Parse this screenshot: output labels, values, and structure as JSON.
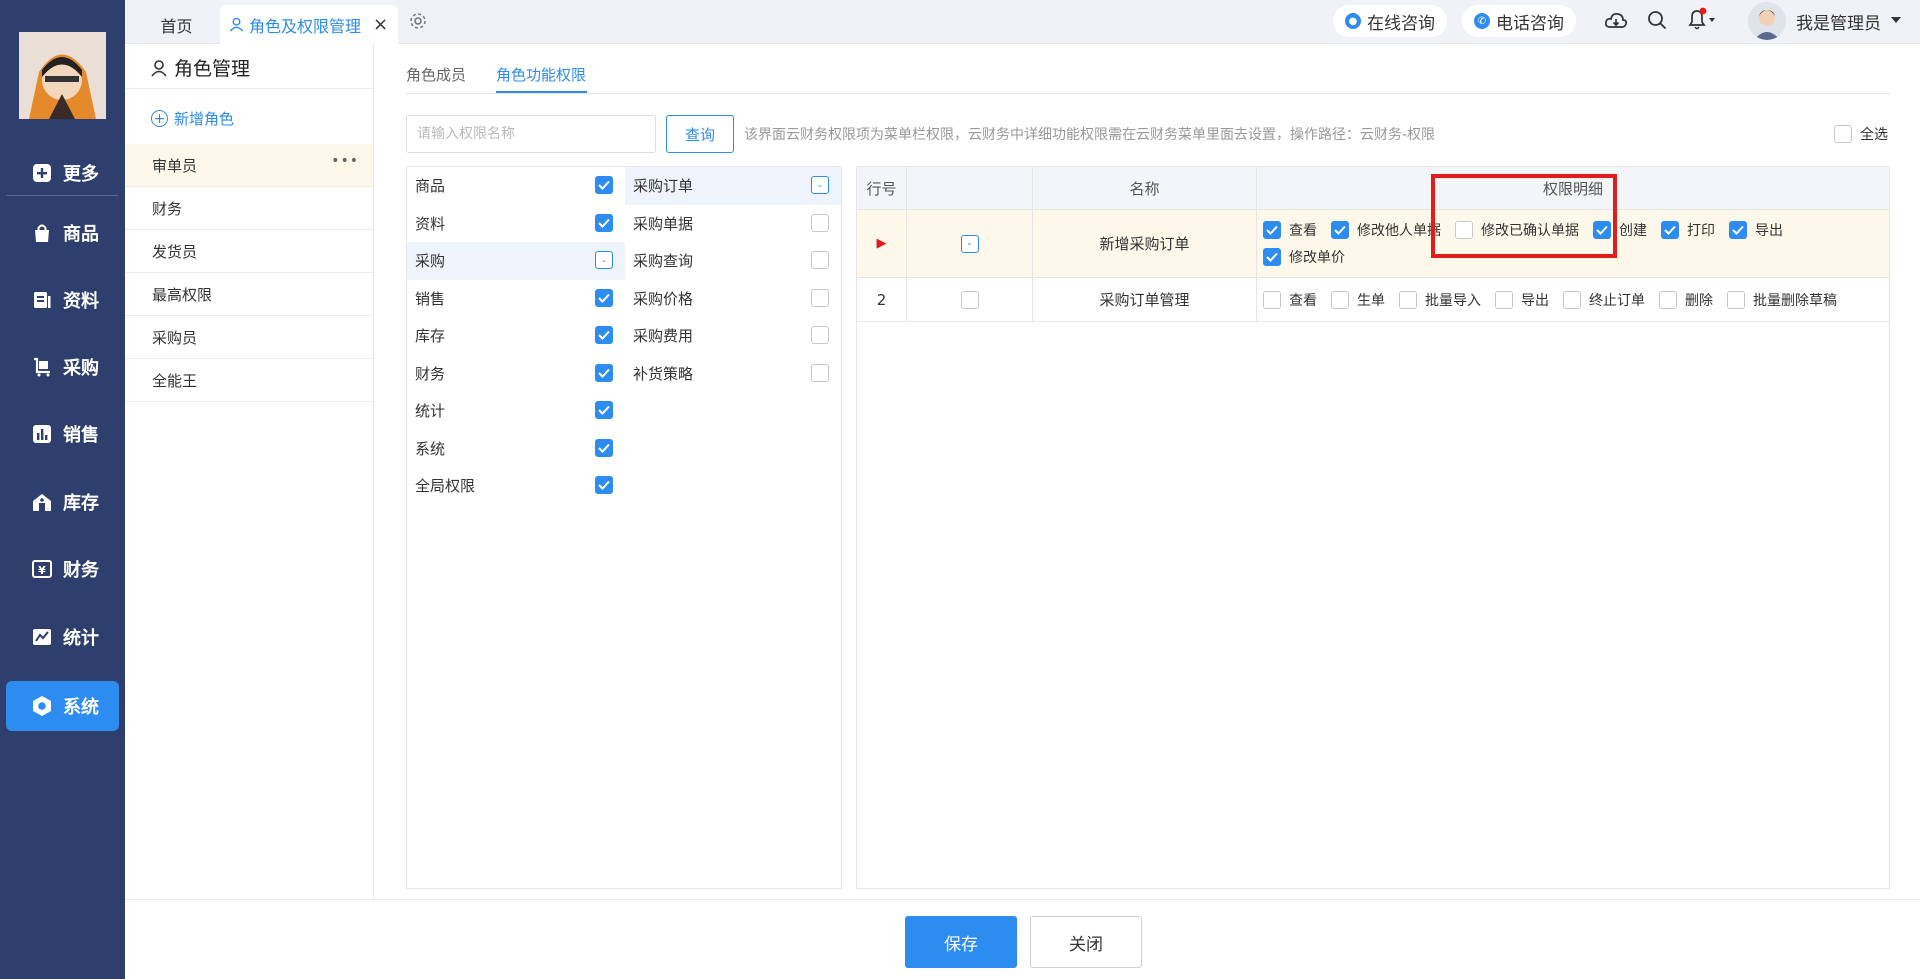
{
  "sidebar": {
    "items": [
      {
        "label": "更多",
        "icon": "plus-square-icon"
      },
      {
        "label": "商品",
        "icon": "bag-icon"
      },
      {
        "label": "资料",
        "icon": "document-icon"
      },
      {
        "label": "采购",
        "icon": "cart-icon"
      },
      {
        "label": "销售",
        "icon": "bar-chart-icon"
      },
      {
        "label": "库存",
        "icon": "warehouse-icon"
      },
      {
        "label": "财务",
        "icon": "yen-icon"
      },
      {
        "label": "统计",
        "icon": "line-chart-icon"
      },
      {
        "label": "系统",
        "icon": "hexagon-gear-icon"
      }
    ],
    "active": "系统"
  },
  "header": {
    "tabs": [
      {
        "label": "首页"
      },
      {
        "label": "角色及权限管理"
      }
    ],
    "online_consult": "在线咨询",
    "phone_consult": "电话咨询",
    "user_name": "我是管理员",
    "accent": "#2d8cf0",
    "notification_dot_color": "#e21b1b"
  },
  "role_panel": {
    "title": "角色管理",
    "add_label": "新增角色",
    "roles": [
      "审单员",
      "财务",
      "发货员",
      "最高权限",
      "采购员",
      "全能王"
    ],
    "selected": "审单员"
  },
  "main": {
    "tabs": [
      "角色成员",
      "角色功能权限"
    ],
    "active_tab": "角色功能权限",
    "search_placeholder": "请输入权限名称",
    "query_label": "查询",
    "hint": "该界面云财务权限项为菜单栏权限，云财务中详细功能权限需在云财务菜单里面去设置，操作路径：云财务-权限",
    "select_all_label": "全选",
    "select_all_checked": false,
    "categories": [
      {
        "label": "商品",
        "state": "checked"
      },
      {
        "label": "资料",
        "state": "checked"
      },
      {
        "label": "采购",
        "state": "partial"
      },
      {
        "label": "销售",
        "state": "checked"
      },
      {
        "label": "库存",
        "state": "checked"
      },
      {
        "label": "财务",
        "state": "checked"
      },
      {
        "label": "统计",
        "state": "checked"
      },
      {
        "label": "系统",
        "state": "checked"
      },
      {
        "label": "全局权限",
        "state": "checked"
      }
    ],
    "sub_categories": [
      {
        "label": "采购订单",
        "state": "partial"
      },
      {
        "label": "采购单据",
        "state": "unchecked"
      },
      {
        "label": "采购查询",
        "state": "unchecked"
      },
      {
        "label": "采购价格",
        "state": "unchecked"
      },
      {
        "label": "采购费用",
        "state": "unchecked"
      },
      {
        "label": "补货策略",
        "state": "unchecked"
      }
    ],
    "table": {
      "headers": {
        "row_no": "行号",
        "name": "名称",
        "detail": "权限明细"
      },
      "rows": [
        {
          "row_no": "▸",
          "name": "新增采购订单",
          "state": "partial",
          "perms": [
            {
              "label": "查看",
              "checked": true
            },
            {
              "label": "修改他人单据",
              "checked": true
            },
            {
              "label": "修改已确认单据",
              "checked": false
            },
            {
              "label": "创建",
              "checked": true
            },
            {
              "label": "打印",
              "checked": true
            },
            {
              "label": "导出",
              "checked": true
            },
            {
              "label": "修改单价",
              "checked": true
            }
          ]
        },
        {
          "row_no": "2",
          "name": "采购订单管理",
          "state": "unchecked",
          "perms": [
            {
              "label": "查看",
              "checked": false
            },
            {
              "label": "生单",
              "checked": false
            },
            {
              "label": "批量导入",
              "checked": false
            },
            {
              "label": "导出",
              "checked": false
            },
            {
              "label": "终止订单",
              "checked": false
            },
            {
              "label": "删除",
              "checked": false
            },
            {
              "label": "批量删除草稿",
              "checked": false
            }
          ]
        }
      ]
    }
  },
  "footer": {
    "save_label": "保存",
    "close_label": "关闭"
  }
}
